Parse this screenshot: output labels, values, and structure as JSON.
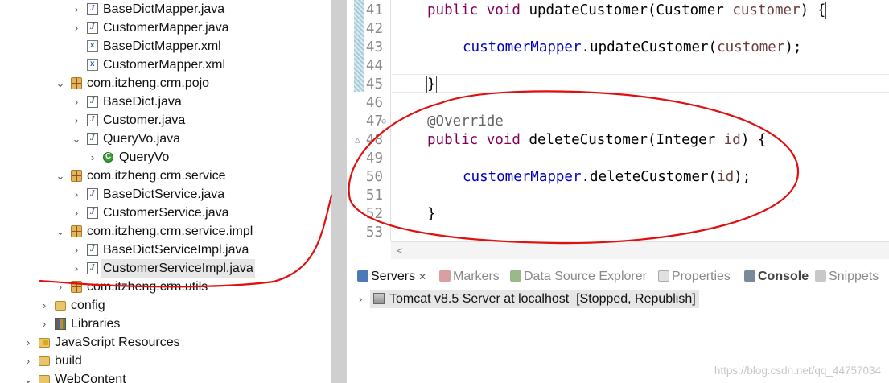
{
  "explorer": {
    "items": [
      {
        "label": "BaseDictMapper.java",
        "icon": "java-interface-icon",
        "depth": 5,
        "expanded": false
      },
      {
        "label": "CustomerMapper.java",
        "icon": "java-interface-icon",
        "depth": 5,
        "expanded": false
      },
      {
        "label": "BaseDictMapper.xml",
        "icon": "xml-file-icon",
        "depth": 5,
        "leaf": true
      },
      {
        "label": "CustomerMapper.xml",
        "icon": "xml-file-icon",
        "depth": 5,
        "leaf": true
      },
      {
        "label": "com.itzheng.crm.pojo",
        "icon": "package-icon",
        "depth": 4,
        "expanded": true
      },
      {
        "label": "BaseDict.java",
        "icon": "java-file-icon",
        "depth": 5,
        "expanded": false
      },
      {
        "label": "Customer.java",
        "icon": "java-file-icon",
        "depth": 5,
        "expanded": false
      },
      {
        "label": "QueryVo.java",
        "icon": "java-file-icon",
        "depth": 5,
        "expanded": true
      },
      {
        "label": "QueryVo",
        "icon": "class-icon",
        "depth": 6,
        "expanded": false
      },
      {
        "label": "com.itzheng.crm.service",
        "icon": "package-icon",
        "depth": 4,
        "expanded": true
      },
      {
        "label": "BaseDictService.java",
        "icon": "java-interface-icon",
        "depth": 5,
        "expanded": false
      },
      {
        "label": "CustomerService.java",
        "icon": "java-interface-icon",
        "depth": 5,
        "expanded": false
      },
      {
        "label": "com.itzheng.crm.service.impl",
        "icon": "package-icon",
        "depth": 4,
        "expanded": true
      },
      {
        "label": "BaseDictServiceImpl.java",
        "icon": "java-file-icon",
        "depth": 5,
        "expanded": false
      },
      {
        "label": "CustomerServiceImpl.java",
        "icon": "java-file-icon",
        "depth": 5,
        "expanded": false,
        "selected": true
      },
      {
        "label": "com.itzheng.crm.utils",
        "icon": "package-icon",
        "depth": 4,
        "expanded": false
      },
      {
        "label": "config",
        "icon": "source-folder-icon",
        "depth": 3,
        "expanded": false
      },
      {
        "label": "Libraries",
        "icon": "libraries-icon",
        "depth": 3,
        "expanded": false
      },
      {
        "label": "JavaScript Resources",
        "icon": "javascript-resources-icon",
        "depth": 2,
        "expanded": false
      },
      {
        "label": "build",
        "icon": "folder-icon",
        "depth": 2,
        "expanded": false
      },
      {
        "label": "WebContent",
        "icon": "folder-icon",
        "depth": 2,
        "expanded": true
      }
    ]
  },
  "editor": {
    "lines": [
      {
        "n": "41",
        "text": "public void updateCustomer(Customer customer) {"
      },
      {
        "n": "42",
        "text": ""
      },
      {
        "n": "43",
        "text": "customerMapper.updateCustomer(customer);"
      },
      {
        "n": "44",
        "text": ""
      },
      {
        "n": "45",
        "text": "}"
      },
      {
        "n": "46",
        "text": ""
      },
      {
        "n": "47",
        "text": "@Override"
      },
      {
        "n": "48",
        "text": "public void deleteCustomer(Integer id) {"
      },
      {
        "n": "49",
        "text": ""
      },
      {
        "n": "50",
        "text": "customerMapper.deleteCustomer(id);"
      },
      {
        "n": "51",
        "text": ""
      },
      {
        "n": "52",
        "text": "}"
      },
      {
        "n": "53",
        "text": ""
      }
    ],
    "scroll_left_glyph": "<"
  },
  "bottom_panel": {
    "tabs": [
      {
        "label": "Servers",
        "icon": "servers-icon",
        "active": true,
        "close": "✕"
      },
      {
        "label": "Markers",
        "icon": "markers-icon"
      },
      {
        "label": "Data Source Explorer",
        "icon": "data-source-explorer-icon"
      },
      {
        "label": "Properties",
        "icon": "properties-icon"
      },
      {
        "label": "Console",
        "icon": "console-icon",
        "bold": true
      },
      {
        "label": "Snippets",
        "icon": "snippets-icon"
      }
    ],
    "server_entry": {
      "name": "Tomcat v8.5 Server at localhost",
      "status": "[Stopped, Republish]"
    }
  },
  "watermark": "https://blog.csdn.net/qq_44757034",
  "colors": {
    "keyword": "#7f0055",
    "field": "#0000c0",
    "annotation_text": "#646464",
    "parameter": "#6a3e3e",
    "red_markup": "#e01010"
  }
}
